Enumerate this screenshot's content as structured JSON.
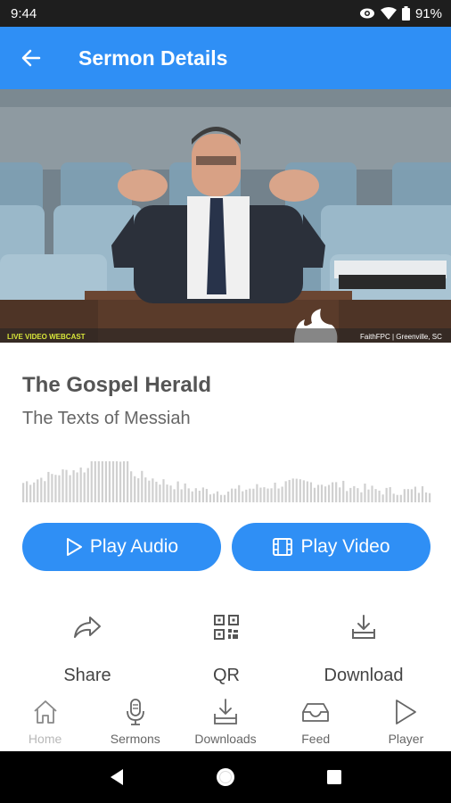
{
  "status_bar": {
    "time": "9:44",
    "battery": "91%"
  },
  "app_bar": {
    "title": "Sermon Details"
  },
  "video": {
    "overlay_left": "LIVE VIDEO WEBCAST",
    "overlay_right": "FaithFPC | Greenville, SC"
  },
  "sermon": {
    "title": "The Gospel Herald",
    "subtitle": "The Texts of Messiah"
  },
  "buttons": {
    "play_audio": "Play Audio",
    "play_video": "Play Video"
  },
  "actions": [
    {
      "label": "Share",
      "icon": "share-icon"
    },
    {
      "label": "QR",
      "icon": "qr-code-icon"
    },
    {
      "label": "Download",
      "icon": "download-icon"
    }
  ],
  "bottom_nav": [
    {
      "label": "Home",
      "icon": "home-icon",
      "active": true
    },
    {
      "label": "Sermons",
      "icon": "microphone-icon"
    },
    {
      "label": "Downloads",
      "icon": "downloads-icon"
    },
    {
      "label": "Feed",
      "icon": "inbox-icon"
    },
    {
      "label": "Player",
      "icon": "play-icon"
    }
  ],
  "colors": {
    "accent": "#2f8ff5",
    "status_bar": "#1e1e1e",
    "waveform": "#d0d0d0"
  }
}
